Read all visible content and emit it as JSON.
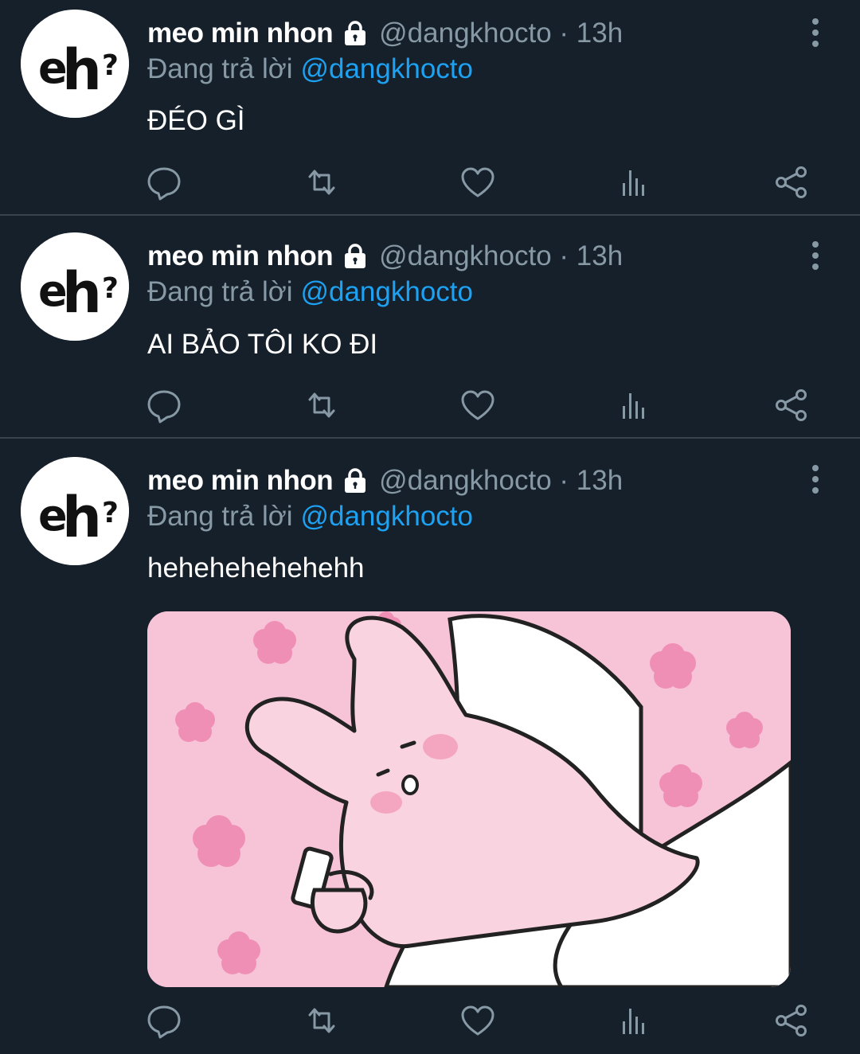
{
  "colors": {
    "background": "#15202b",
    "divider": "#38444d",
    "secondary_text": "#8899a6",
    "mention": "#1da1f2",
    "primary_text": "#ffffff"
  },
  "avatar": {
    "text": "eh?"
  },
  "tweets": [
    {
      "display_name": "meo min nhon",
      "handle_time": "@dangkhocto · 13h",
      "replying_prefix": "Đang trả lời",
      "replying_to": "@dangkhocto",
      "text": "ĐÉO GÌ",
      "icons": [
        "reply-icon",
        "retweet-icon",
        "like-icon",
        "analytics-icon",
        "share-icon"
      ]
    },
    {
      "display_name": "meo min nhon",
      "handle_time": "@dangkhocto · 13h",
      "replying_prefix": "Đang trả lời",
      "replying_to": "@dangkhocto",
      "text": "AI BẢO TÔI KO ĐI",
      "icons": [
        "reply-icon",
        "retweet-icon",
        "like-icon",
        "analytics-icon",
        "share-icon"
      ]
    },
    {
      "display_name": "meo min nhon",
      "handle_time": "@dangkhocto · 13h",
      "replying_prefix": "Đang trả lời",
      "replying_to": "@dangkhocto",
      "text": "hehehehehehehh",
      "media": "pink-bunny-with-phone-image",
      "icons": [
        "reply-icon",
        "retweet-icon",
        "like-icon",
        "analytics-icon",
        "share-icon"
      ]
    }
  ]
}
